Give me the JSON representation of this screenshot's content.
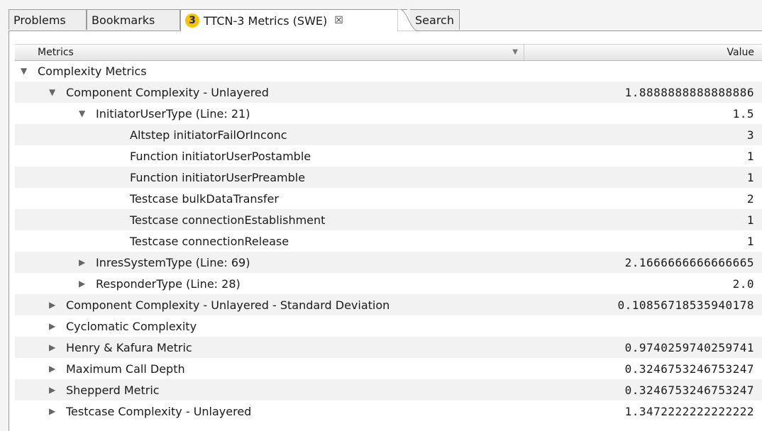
{
  "tabs": [
    {
      "label": "Problems"
    },
    {
      "label": "Bookmarks"
    },
    {
      "label": "TTCN-3 Metrics (SWE)",
      "icon": "ttcn3-icon",
      "active": true
    },
    {
      "label": "Search"
    }
  ],
  "table": {
    "columns": {
      "metrics": "Metrics",
      "value": "Value"
    },
    "rows": [
      {
        "indent": 0,
        "expander": "expanded",
        "label": "Complexity Metrics",
        "value": ""
      },
      {
        "indent": 1,
        "expander": "expanded",
        "label": "Component Complexity - Unlayered",
        "value": "1.8888888888888886"
      },
      {
        "indent": 2,
        "expander": "expanded",
        "label": "InitiatorUserType (Line: 21)",
        "value": "1.5"
      },
      {
        "indent": 3,
        "expander": "none",
        "label": "Altstep initiatorFailOrInconc",
        "value": "3"
      },
      {
        "indent": 3,
        "expander": "none",
        "label": "Function initiatorUserPostamble",
        "value": "1"
      },
      {
        "indent": 3,
        "expander": "none",
        "label": "Function initiatorUserPreamble",
        "value": "1"
      },
      {
        "indent": 3,
        "expander": "none",
        "label": "Testcase bulkDataTransfer",
        "value": "2"
      },
      {
        "indent": 3,
        "expander": "none",
        "label": "Testcase connectionEstablishment",
        "value": "1"
      },
      {
        "indent": 3,
        "expander": "none",
        "label": "Testcase connectionRelease",
        "value": "1"
      },
      {
        "indent": 2,
        "expander": "collapsed",
        "label": "InresSystemType (Line: 69)",
        "value": "2.1666666666666665"
      },
      {
        "indent": 2,
        "expander": "collapsed",
        "label": "ResponderType (Line: 28)",
        "value": "2.0"
      },
      {
        "indent": 1,
        "expander": "collapsed",
        "label": "Component Complexity - Unlayered - Standard Deviation",
        "value": "0.10856718535940178"
      },
      {
        "indent": 1,
        "expander": "collapsed",
        "label": "Cyclomatic Complexity",
        "value": ""
      },
      {
        "indent": 1,
        "expander": "collapsed",
        "label": "Henry & Kafura Metric",
        "value": "0.9740259740259741"
      },
      {
        "indent": 1,
        "expander": "collapsed",
        "label": "Maximum Call Depth",
        "value": "0.3246753246753247"
      },
      {
        "indent": 1,
        "expander": "collapsed",
        "label": "Shepperd Metric",
        "value": "0.3246753246753247"
      },
      {
        "indent": 1,
        "expander": "collapsed",
        "label": "Testcase Complexity - Unlayered",
        "value": "1.3472222222222222"
      }
    ]
  }
}
